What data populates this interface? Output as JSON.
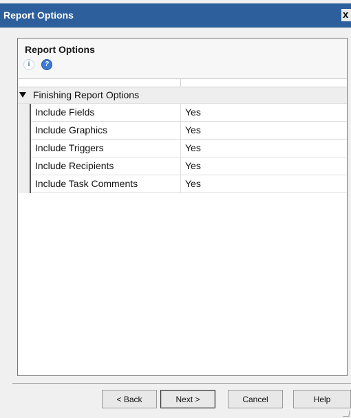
{
  "window": {
    "title": "Report Options",
    "close_glyph": "x"
  },
  "panel": {
    "title": "Report Options",
    "icons": [
      "info-icon",
      "help-icon"
    ],
    "info_glyph": "i",
    "help_glyph": "?"
  },
  "grid": {
    "category": {
      "label": "Finishing Report Options",
      "expanded": true
    },
    "rows": [
      {
        "name": "Include Fields",
        "value": "Yes"
      },
      {
        "name": "Include Graphics",
        "value": "Yes"
      },
      {
        "name": "Include Triggers",
        "value": "Yes"
      },
      {
        "name": "Include Recipients",
        "value": "Yes"
      },
      {
        "name": "Include Task Comments",
        "value": "Yes"
      }
    ]
  },
  "buttons": {
    "back": "< Back",
    "next": "Next >",
    "cancel": "Cancel",
    "help": "Help"
  },
  "colors": {
    "titlebar": "#2c5f9c",
    "dialog_bg": "#f0f0f0",
    "help_icon": "#3d7ad6"
  }
}
